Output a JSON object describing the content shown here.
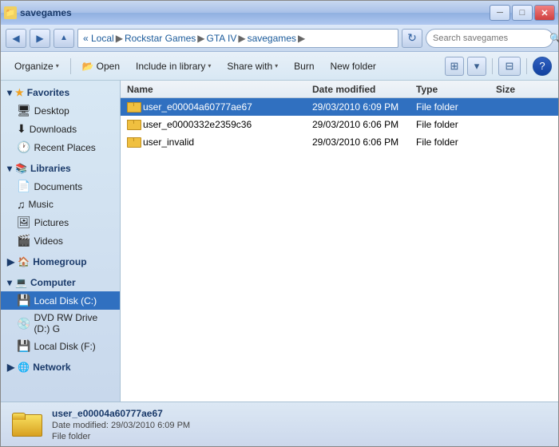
{
  "window": {
    "title": "savegames",
    "title_icon": "📁"
  },
  "title_bar": {
    "controls": {
      "minimize": "─",
      "maximize": "□",
      "close": "✕"
    }
  },
  "address_bar": {
    "back_btn": "◀",
    "forward_btn": "▶",
    "path_segments": [
      {
        "label": "« Local",
        "sep": "▶"
      },
      {
        "label": "Rockstar Games",
        "sep": "▶"
      },
      {
        "label": "GTA IV",
        "sep": "▶"
      },
      {
        "label": "savegames",
        "sep": "▶"
      }
    ],
    "refresh_btn": "↻",
    "search_placeholder": "Search savegames",
    "search_icon": "🔍"
  },
  "toolbar": {
    "organize_label": "Organize",
    "open_label": "Open",
    "include_library_label": "Include in library",
    "share_with_label": "Share with",
    "burn_label": "Burn",
    "new_folder_label": "New folder",
    "dropdown_arrow": "▾",
    "view_icon": "☰",
    "help_icon": "?"
  },
  "columns": {
    "name": "Name",
    "date_modified": "Date modified",
    "type": "Type",
    "size": "Size"
  },
  "files": [
    {
      "name": "user_e00004a60777ae67",
      "date_modified": "29/03/2010 6:09 PM",
      "type": "File folder",
      "size": "",
      "selected": true
    },
    {
      "name": "user_e0000332e2359c36",
      "date_modified": "29/03/2010 6:06 PM",
      "type": "File folder",
      "size": "",
      "selected": false
    },
    {
      "name": "user_invalid",
      "date_modified": "29/03/2010 6:06 PM",
      "type": "File folder",
      "size": "",
      "selected": false
    }
  ],
  "sidebar": {
    "favorites": {
      "label": "Favorites",
      "items": [
        {
          "label": "Desktop",
          "icon": "desktop"
        },
        {
          "label": "Downloads",
          "icon": "download"
        },
        {
          "label": "Recent Places",
          "icon": "recent"
        }
      ]
    },
    "libraries": {
      "label": "Libraries",
      "items": [
        {
          "label": "Documents",
          "icon": "documents"
        },
        {
          "label": "Music",
          "icon": "music"
        },
        {
          "label": "Pictures",
          "icon": "pictures"
        },
        {
          "label": "Videos",
          "icon": "videos"
        }
      ]
    },
    "homegroup": {
      "label": "Homegroup"
    },
    "computer": {
      "label": "Computer",
      "items": [
        {
          "label": "Local Disk (C:)",
          "icon": "disk",
          "selected": true
        },
        {
          "label": "DVD RW Drive (D:) G",
          "icon": "dvd"
        },
        {
          "label": "Local Disk (F:)",
          "icon": "disk"
        }
      ]
    },
    "network": {
      "label": "Network"
    }
  },
  "status": {
    "filename": "user_e00004a60777ae67",
    "meta_label": "Date modified:",
    "meta_value": "29/03/2010 6:09 PM",
    "type": "File folder"
  }
}
